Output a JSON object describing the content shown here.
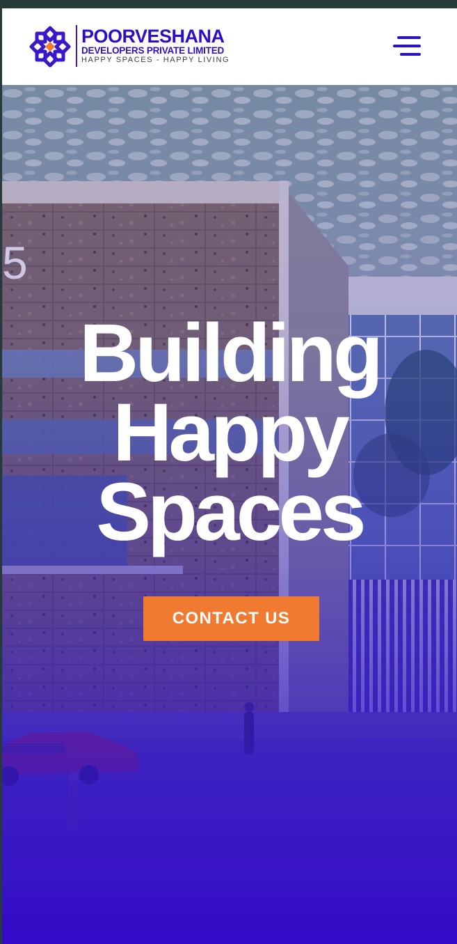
{
  "header": {
    "logo_icon": "poorveshana-emblem-icon",
    "brand_name": "POORVESHANA",
    "brand_subtitle": "DEVELOPERS PRIVATE LIMITED",
    "tagline": "HAPPY SPACES - HAPPY LIVING",
    "menu_icon": "hamburger-menu-icon"
  },
  "hero": {
    "headline_line1": "Building",
    "headline_line2": "Happy",
    "headline_line3": "Spaces",
    "cta_label": "CONTACT US",
    "building_number": "5"
  },
  "colors": {
    "brand_primary": "#2c0fc3",
    "cta_orange": "#f07b30",
    "overlay_purple": "#3a0fd0"
  }
}
